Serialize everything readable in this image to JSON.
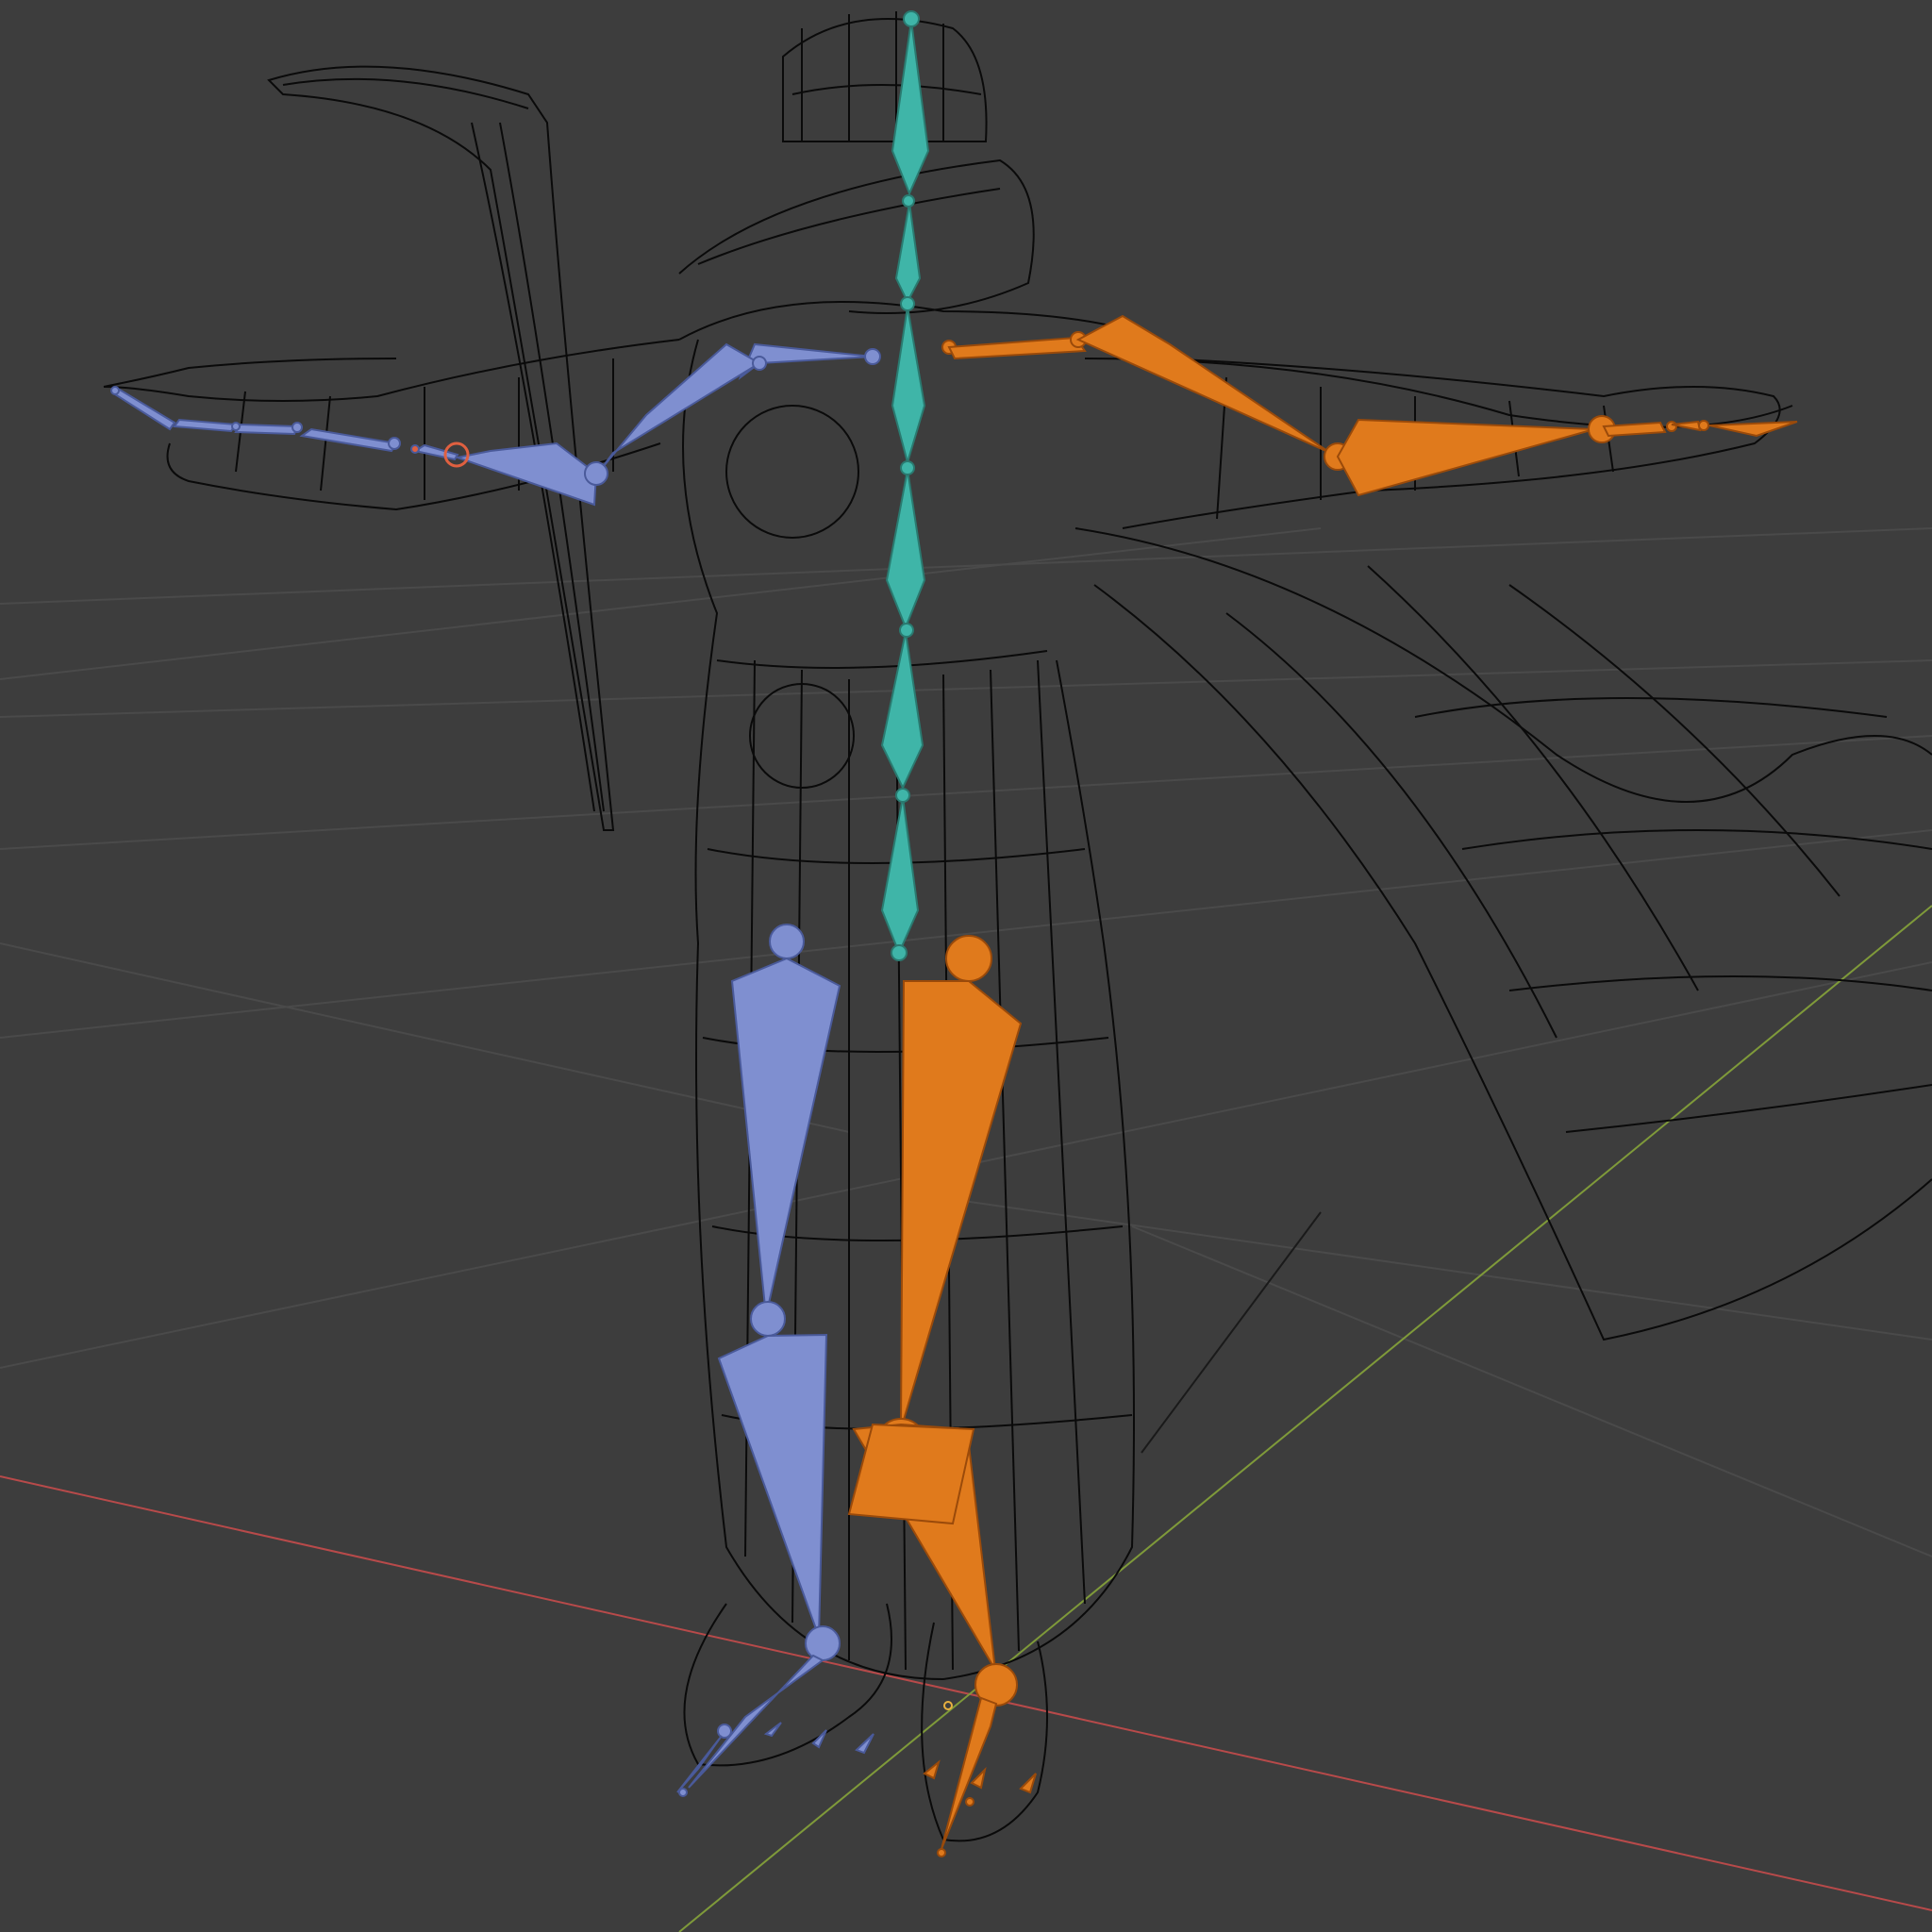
{
  "viewport": {
    "background": "#3d3d3d",
    "grid_color": "#4a4a4a",
    "axis_x_color": "#b84a4a",
    "axis_y_color": "#7f9a3a",
    "wire_color": "#0a0a0a"
  },
  "armature": {
    "center_color": "#3fb5a8",
    "left_color": "#7f8fd0",
    "right_color": "#e07a1c",
    "selected_color": "#e06040"
  }
}
